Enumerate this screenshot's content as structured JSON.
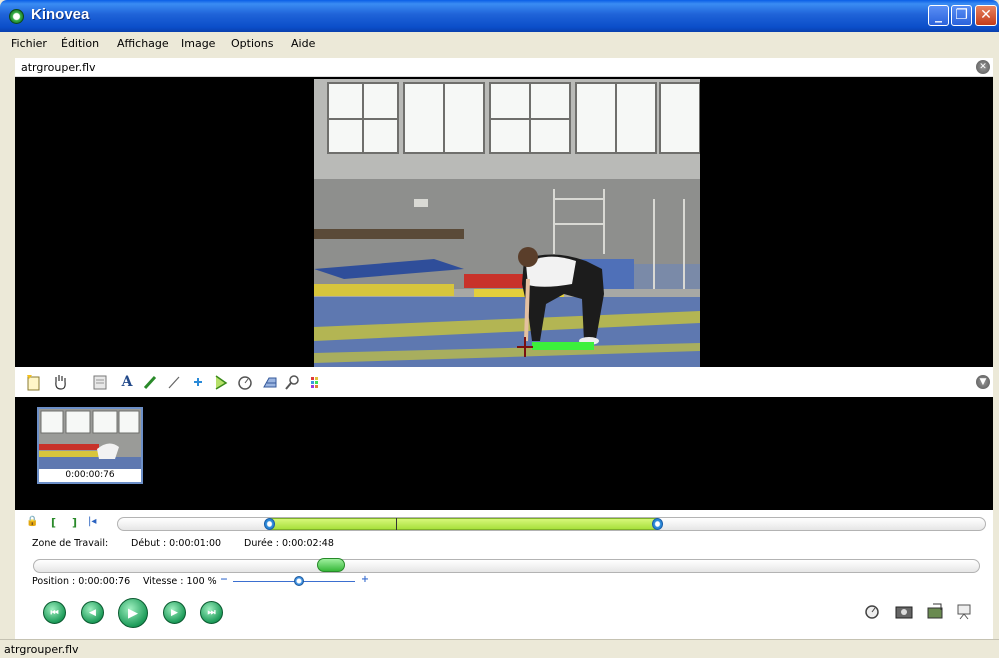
{
  "window": {
    "title": "Kinovea",
    "minimize_glyph": "_",
    "maximize_glyph": "❐",
    "close_glyph": "✕"
  },
  "menu": [
    "Fichier",
    "Édition",
    "Affichage",
    "Image",
    "Options",
    "Aide"
  ],
  "screen": {
    "file_name": "atrgrouper.flv",
    "close_glyph": "✕",
    "collapse_glyph": "▼"
  },
  "toolbar": {
    "icons": [
      "add-keyframe-icon",
      "hand-icon",
      "comment-icon",
      "text-icon",
      "pencil-icon",
      "line-icon",
      "cross-marker-icon",
      "angle-icon",
      "chrono-icon",
      "grid-icon",
      "magnifier-icon",
      "color-profile-icon"
    ],
    "text_tool_glyph": "A"
  },
  "thumbnails": [
    {
      "timecode": "0:00:00:76"
    }
  ],
  "working_zone": {
    "label": "Zone de Travail:",
    "start": "Début : 0:00:01:00",
    "duration": "Durée : 0:00:02:48",
    "lock_glyph": "🔒",
    "start_bracket": "[",
    "end_bracket": "]",
    "goto_start_glyph": "|◂"
  },
  "position": {
    "label": "Position : 0:00:00:76",
    "speed": "Vitesse : 100 %",
    "speed_minus": "−",
    "speed_plus": "+"
  },
  "playback": {
    "first": "⏮",
    "previous": "◀",
    "play": "▶",
    "next": "▶",
    "last": "⏭"
  },
  "status": {
    "text": "atrgrouper.flv"
  },
  "colors": {
    "title_blue": "#0b4ec9",
    "selection_green": "#a8e03c",
    "play_green": "#1e9c5a"
  }
}
